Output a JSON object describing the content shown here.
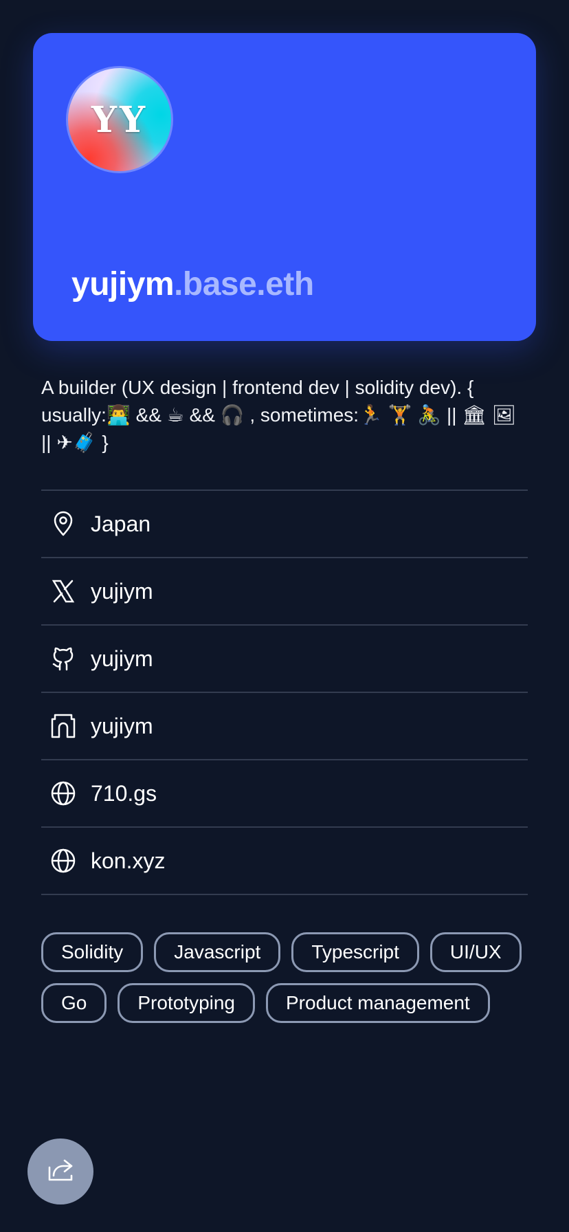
{
  "profile": {
    "avatar_initials": "YY",
    "name": "yujiym",
    "name_suffix": ".base.eth",
    "bio": "A builder (UX design | frontend dev | solidity dev). { usually:👨‍💻 && ☕ && 🎧 , sometimes:🏃 🏋 🚴 || 🏛 🖼 || ✈🧳 }"
  },
  "links": [
    {
      "icon": "location-pin-icon",
      "label": "Japan"
    },
    {
      "icon": "x-logo-icon",
      "label": "yujiym"
    },
    {
      "icon": "github-icon",
      "label": "yujiym"
    },
    {
      "icon": "farcaster-icon",
      "label": "yujiym"
    },
    {
      "icon": "globe-icon",
      "label": "710.gs"
    },
    {
      "icon": "globe-icon",
      "label": "kon.xyz"
    }
  ],
  "tags": [
    "Solidity",
    "Javascript",
    "Typescript",
    "UI/UX",
    "Go",
    "Prototyping",
    "Product management"
  ],
  "share": {
    "icon": "share-icon"
  },
  "colors": {
    "background": "#0e1628",
    "card": "#3555fb",
    "name_suffix": "#a8b8ff",
    "divider": "#333c50",
    "tag_border": "#8c99b3",
    "share_button": "#8b98b2"
  }
}
